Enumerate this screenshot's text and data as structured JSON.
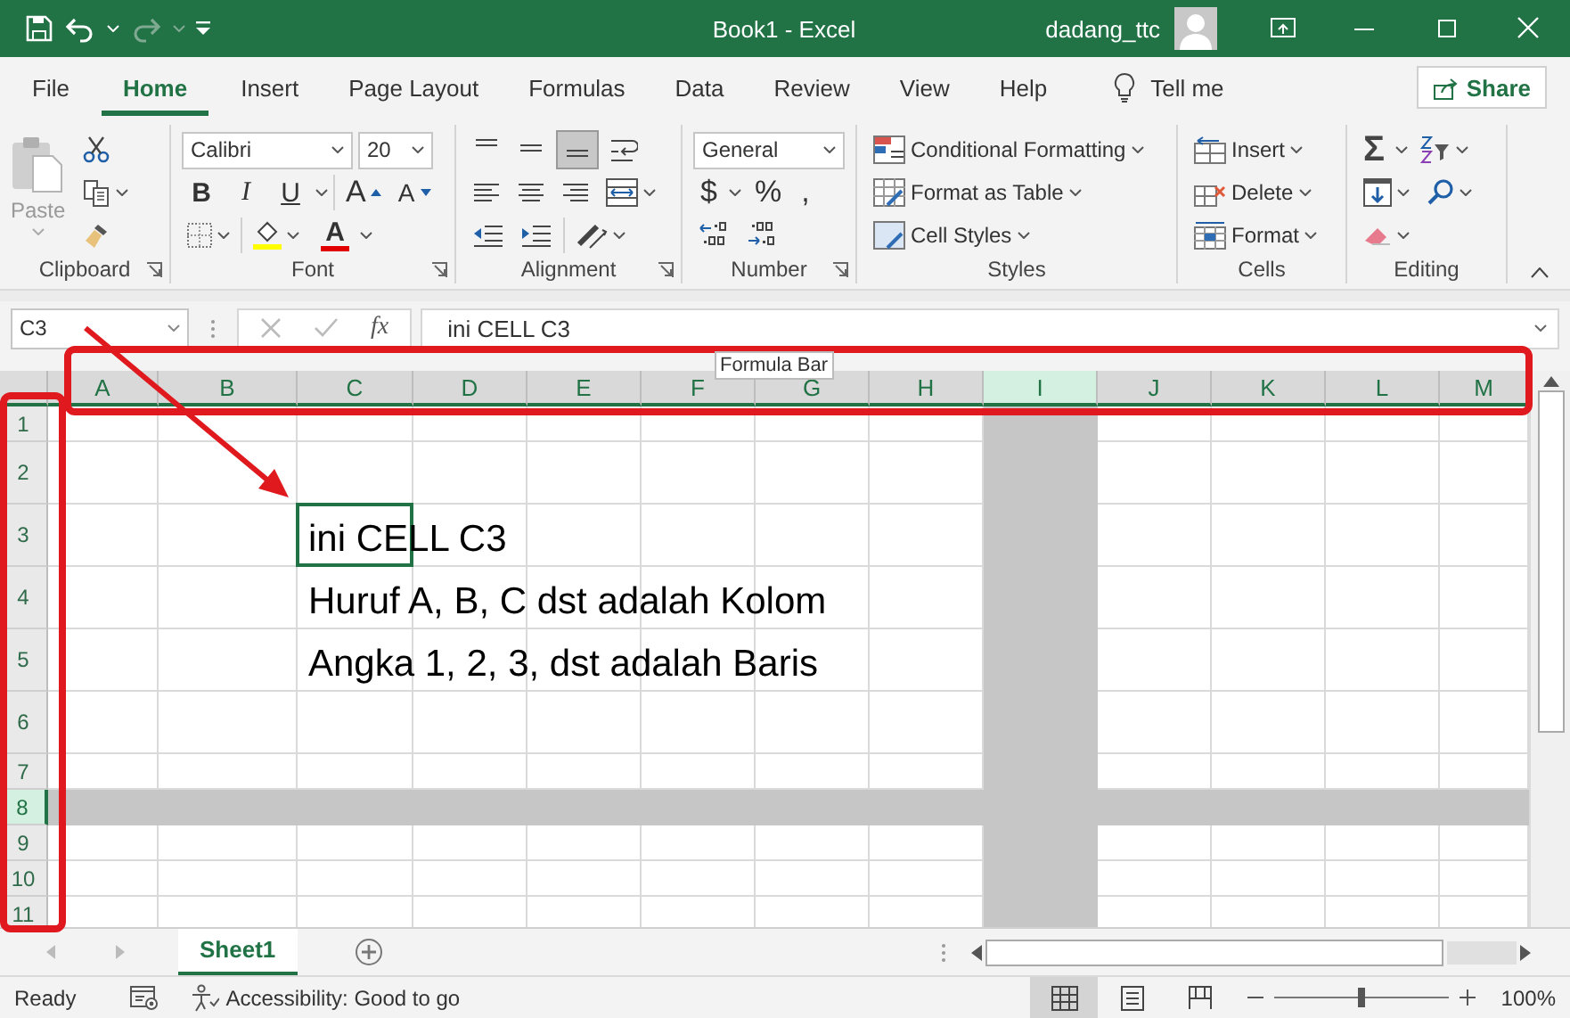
{
  "title_bar": {
    "title": "Book1  -  Excel",
    "user": "dadang_ttc"
  },
  "menu_tabs": [
    {
      "label": "File",
      "selected": false
    },
    {
      "label": "Home",
      "selected": true
    },
    {
      "label": "Insert",
      "selected": false
    },
    {
      "label": "Page Layout",
      "selected": false
    },
    {
      "label": "Formulas",
      "selected": false
    },
    {
      "label": "Data",
      "selected": false
    },
    {
      "label": "Review",
      "selected": false
    },
    {
      "label": "View",
      "selected": false
    },
    {
      "label": "Help",
      "selected": false
    }
  ],
  "tell_me": "Tell me",
  "share_button": "Share",
  "ribbon": [
    {
      "kind": "clipboard",
      "label": "Clipboard",
      "paste": "Paste"
    },
    {
      "kind": "font",
      "label": "Font",
      "font_name": "Calibri",
      "font_size": "20",
      "format_buttons": [
        {
          "kind": "bold",
          "label": "B"
        },
        {
          "kind": "italic",
          "label": "I"
        },
        {
          "kind": "underline",
          "label": "U"
        }
      ],
      "grow": "A",
      "shrink": "A",
      "font_color": "A"
    },
    {
      "kind": "alignment",
      "label": "Alignment",
      "vertical_buttons": [
        {
          "kind": "top",
          "selected": false
        },
        {
          "kind": "middle",
          "selected": false
        },
        {
          "kind": "bottom",
          "selected": true
        }
      ]
    },
    {
      "kind": "number",
      "label": "Number",
      "format": "General",
      "currency": "$",
      "percent": "%",
      "comma": ","
    },
    {
      "kind": "styles",
      "label": "Styles",
      "items": [
        "Conditional Formatting",
        "Format as Table",
        "Cell Styles"
      ]
    },
    {
      "kind": "cells",
      "label": "Cells",
      "items": [
        "Insert",
        "Delete",
        "Format"
      ]
    },
    {
      "kind": "editing",
      "label": "Editing",
      "sum": "Σ"
    }
  ],
  "formula_bar": {
    "name_box": "C3",
    "function_label": "fx",
    "formula": "ini CELL C3"
  },
  "tooltip": "Formula Bar",
  "sheet": {
    "columns": [
      {
        "label": "A",
        "selected": false
      },
      {
        "label": "B",
        "selected": false
      },
      {
        "label": "C",
        "selected": false,
        "active": true
      },
      {
        "label": "D",
        "selected": false
      },
      {
        "label": "E",
        "selected": false
      },
      {
        "label": "F",
        "selected": false
      },
      {
        "label": "G",
        "selected": false
      },
      {
        "label": "H",
        "selected": false
      },
      {
        "label": "I",
        "selected": true
      },
      {
        "label": "J",
        "selected": false
      },
      {
        "label": "K",
        "selected": false
      },
      {
        "label": "L",
        "selected": false
      },
      {
        "label": "M",
        "selected": false
      }
    ],
    "rows": [
      {
        "label": "1",
        "kind": "short",
        "selected": false
      },
      {
        "label": "2",
        "kind": "tall",
        "selected": false
      },
      {
        "label": "3",
        "kind": "tall",
        "selected": false,
        "active": true,
        "text": "ini CELL C3"
      },
      {
        "label": "4",
        "kind": "tall",
        "selected": false,
        "text": "Huruf A, B, C dst adalah Kolom"
      },
      {
        "label": "5",
        "kind": "tall",
        "selected": false,
        "text": "Angka 1, 2, 3, dst adalah Baris"
      },
      {
        "label": "6",
        "kind": "tall",
        "selected": false
      },
      {
        "label": "7",
        "kind": "short",
        "selected": false
      },
      {
        "label": "8",
        "kind": "short",
        "selected": true
      },
      {
        "label": "9",
        "kind": "short",
        "selected": false
      },
      {
        "label": "10",
        "kind": "short",
        "selected": false
      },
      {
        "label": "11",
        "kind": "short",
        "selected": false
      }
    ]
  },
  "sheet_tabs": [
    {
      "label": "Sheet1",
      "selected": true
    }
  ],
  "status_bar": {
    "mode": "Ready",
    "accessibility": "Accessibility: Good to go",
    "views": [
      {
        "kind": "normal",
        "selected": true
      },
      {
        "kind": "page_layout",
        "selected": false
      },
      {
        "kind": "page_break",
        "selected": false
      }
    ],
    "zoom": {
      "level": 0.5,
      "reading": "100%"
    }
  }
}
